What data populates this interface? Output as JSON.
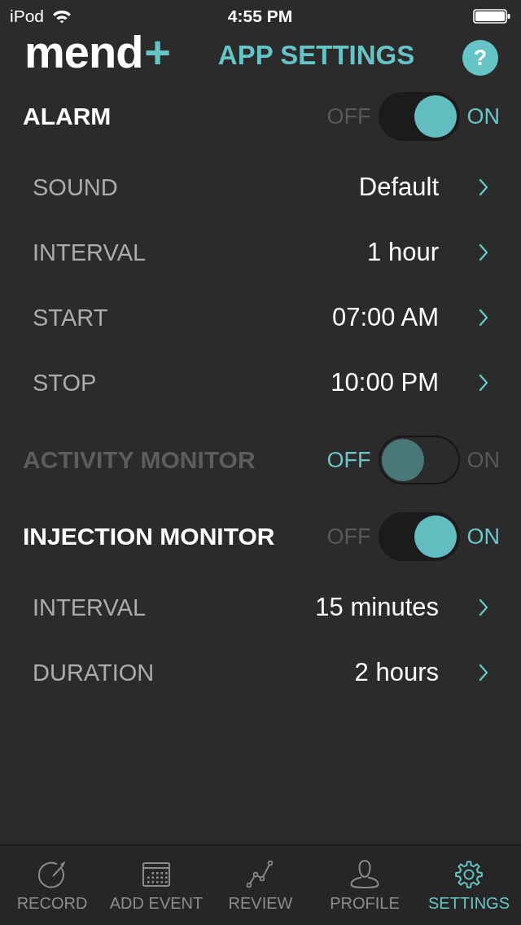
{
  "status_bar": {
    "carrier": "iPod",
    "time": "4:55 PM"
  },
  "header": {
    "logo": {
      "word": "mend",
      "plus": "+"
    },
    "title": "APP SETTINGS",
    "help": "?"
  },
  "settings": [
    {
      "kind": "toggle",
      "label": "ALARM",
      "on": true,
      "off_label": "OFF",
      "on_label": "ON"
    },
    {
      "kind": "option",
      "label": "SOUND",
      "value": "Default"
    },
    {
      "kind": "option",
      "label": "INTERVAL",
      "value": "1 hour"
    },
    {
      "kind": "option",
      "label": "START",
      "value": "07:00 AM"
    },
    {
      "kind": "option",
      "label": "STOP",
      "value": "10:00 PM"
    },
    {
      "kind": "toggle",
      "label": "ACTIVITY MONITOR",
      "on": false,
      "off_label": "OFF",
      "on_label": "ON"
    },
    {
      "kind": "toggle",
      "label": "INJECTION MONITOR",
      "on": true,
      "off_label": "OFF",
      "on_label": "ON"
    },
    {
      "kind": "option",
      "label": "INTERVAL",
      "value": "15 minutes"
    },
    {
      "kind": "option",
      "label": "DURATION",
      "value": "2 hours"
    }
  ],
  "tab_bar": [
    {
      "label": "RECORD",
      "selected": false
    },
    {
      "label": "ADD EVENT",
      "selected": false
    },
    {
      "label": "REVIEW",
      "selected": false
    },
    {
      "label": "PROFILE",
      "selected": false
    },
    {
      "label": "SETTINGS",
      "selected": true
    }
  ]
}
